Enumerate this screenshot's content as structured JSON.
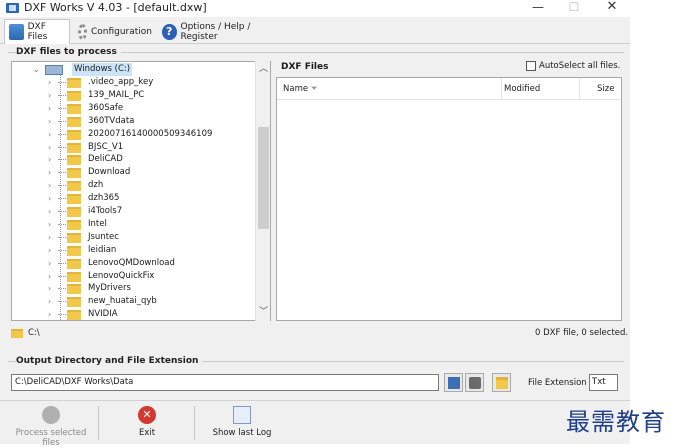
{
  "window": {
    "title": "DXF Works V 4.03 - [default.dxw]",
    "min_glyph": "—",
    "max_glyph": "☐",
    "close_glyph": "✕"
  },
  "tabs": [
    {
      "label": "DXF Files",
      "icon": "file-icon",
      "active": true
    },
    {
      "label": "Configuration",
      "icon": "gear-icon"
    },
    {
      "label": "Options / Help / Register",
      "icon": "help-icon"
    }
  ],
  "process_group": {
    "label": "DXF files to process"
  },
  "tree": {
    "root": "Windows (C:)",
    "folders": [
      ".video_app_key",
      "139_MAIL_PC",
      "360Safe",
      "360TVdata",
      "20200716140000509346109",
      "BJSC_V1",
      "DeliCAD",
      "Download",
      "dzh",
      "dzh365",
      "i4Tools7",
      "Intel",
      "Jsuntec",
      "leidian",
      "LenovoQMDownload",
      "LenovoQuickFix",
      "MyDrivers",
      "new_huatai_qyb",
      "NVIDIA"
    ],
    "current_path": "C:\\"
  },
  "file_list": {
    "title": "DXF Files",
    "autoselect_label": "AutoSelect all files.",
    "autoselect_checked": false,
    "columns": [
      "Name",
      "Modified",
      "Size"
    ],
    "rows": [],
    "status": "0 DXF file, 0 selected."
  },
  "output": {
    "label": "Output Directory and File Extension",
    "directory": "C:\\DeliCAD\\DXF Works\\Data",
    "extension_label": "File Extension :",
    "extension": "Txt"
  },
  "actions": {
    "process": "Process selected files",
    "exit": "Exit",
    "log": "Show last Log"
  },
  "watermark": "最需教育"
}
